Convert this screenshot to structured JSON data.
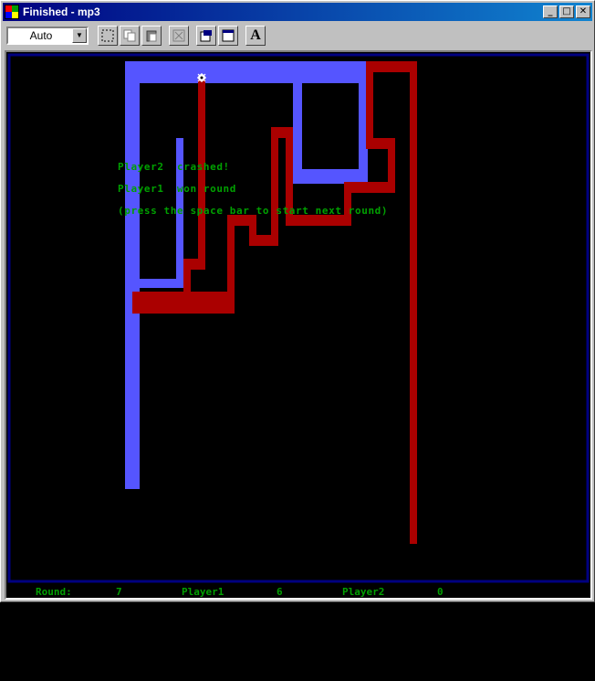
{
  "window": {
    "title": "Finished - mp3",
    "minimize_glyph": "_",
    "maximize_glyph": "□",
    "close_glyph": "✕"
  },
  "toolbar": {
    "font_size_value": "Auto",
    "font_button_label": "A"
  },
  "messages": {
    "line1": "Player2  crashed!",
    "line2": "Player1  won round",
    "line3": "(press the space bar to start next round)"
  },
  "status": {
    "round_label": "Round:",
    "round_value": "7",
    "player1_label": "Player1",
    "player1_score": "6",
    "player2_label": "Player2",
    "player2_score": "0"
  },
  "colors": {
    "player1_trail": "#5555ff",
    "player2_trail": "#aa0000",
    "border": "#000080",
    "text": "#00a000"
  }
}
